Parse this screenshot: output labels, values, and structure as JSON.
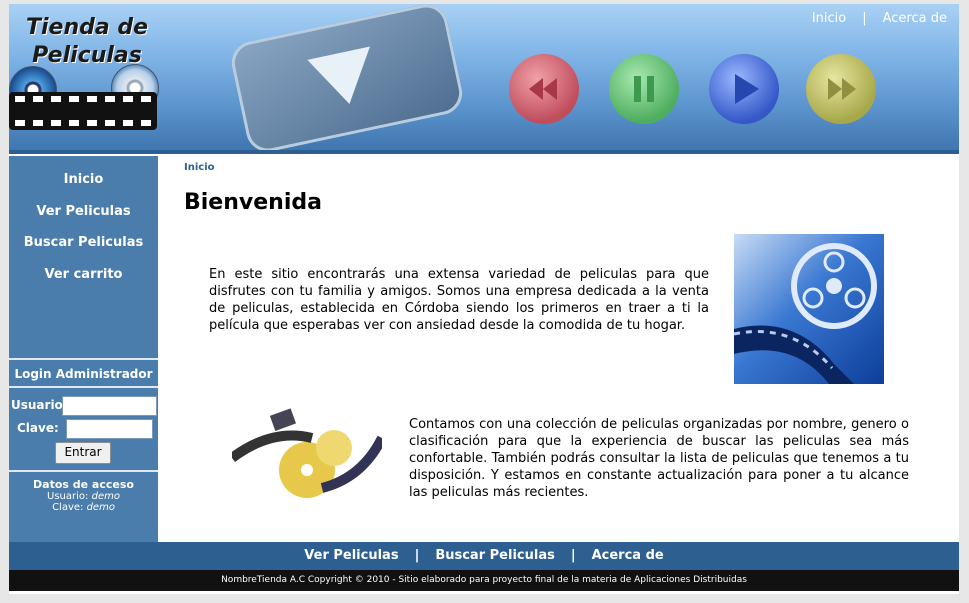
{
  "header": {
    "logo_line1": "Tienda de",
    "logo_line2": "Peliculas",
    "nav": [
      "Inicio",
      "Acerca de"
    ],
    "nav_separator": "|"
  },
  "sidebar": {
    "links": [
      "Inicio",
      "Ver Peliculas",
      "Buscar Peliculas",
      "Ver carrito"
    ],
    "login_title": "Login Administrador",
    "usuario_label": "Usuario:",
    "clave_label": "Clave:",
    "usuario_value": "",
    "clave_value": "",
    "submit_label": "Entrar",
    "access_title": "Datos de acceso",
    "access_user_label": "Usuario:",
    "access_user_value": "demo",
    "access_pass_label": "Clave:",
    "access_pass_value": "demo"
  },
  "main": {
    "breadcrumb": "Inicio",
    "title": "Bienvenida",
    "paragraph1": "En este sitio encontrarás una extensa variedad de peliculas para que disfrutes con tu familia y amigos. Somos una empresa dedicada a la venta de peliculas, establecida en Córdoba siendo los primeros en traer a ti la película que esperabas ver con ansiedad desde la comodida de tu hogar.",
    "paragraph2": "Contamos con una colección de peliculas organizadas por nombre, genero o clasificación para que la experiencia de buscar las peliculas sea más confortable. También podrás consultar la lista de peliculas que tenemos a tu disposición. Y estamos en constante actualización para poner a tu alcance las peliculas más recientes."
  },
  "footer": {
    "links": [
      "Ver Peliculas",
      "Buscar Peliculas",
      "Acerca de"
    ],
    "separator": "|",
    "copyright": "NombreTienda A.C Copyright © 2010 - Sitio elaborado para proyecto final de la materia de Aplicaciones Distribuidas"
  },
  "colors": {
    "sidebar": "#4a7dab",
    "footer_nav": "#2e5f91",
    "footer_copy": "#111111"
  }
}
